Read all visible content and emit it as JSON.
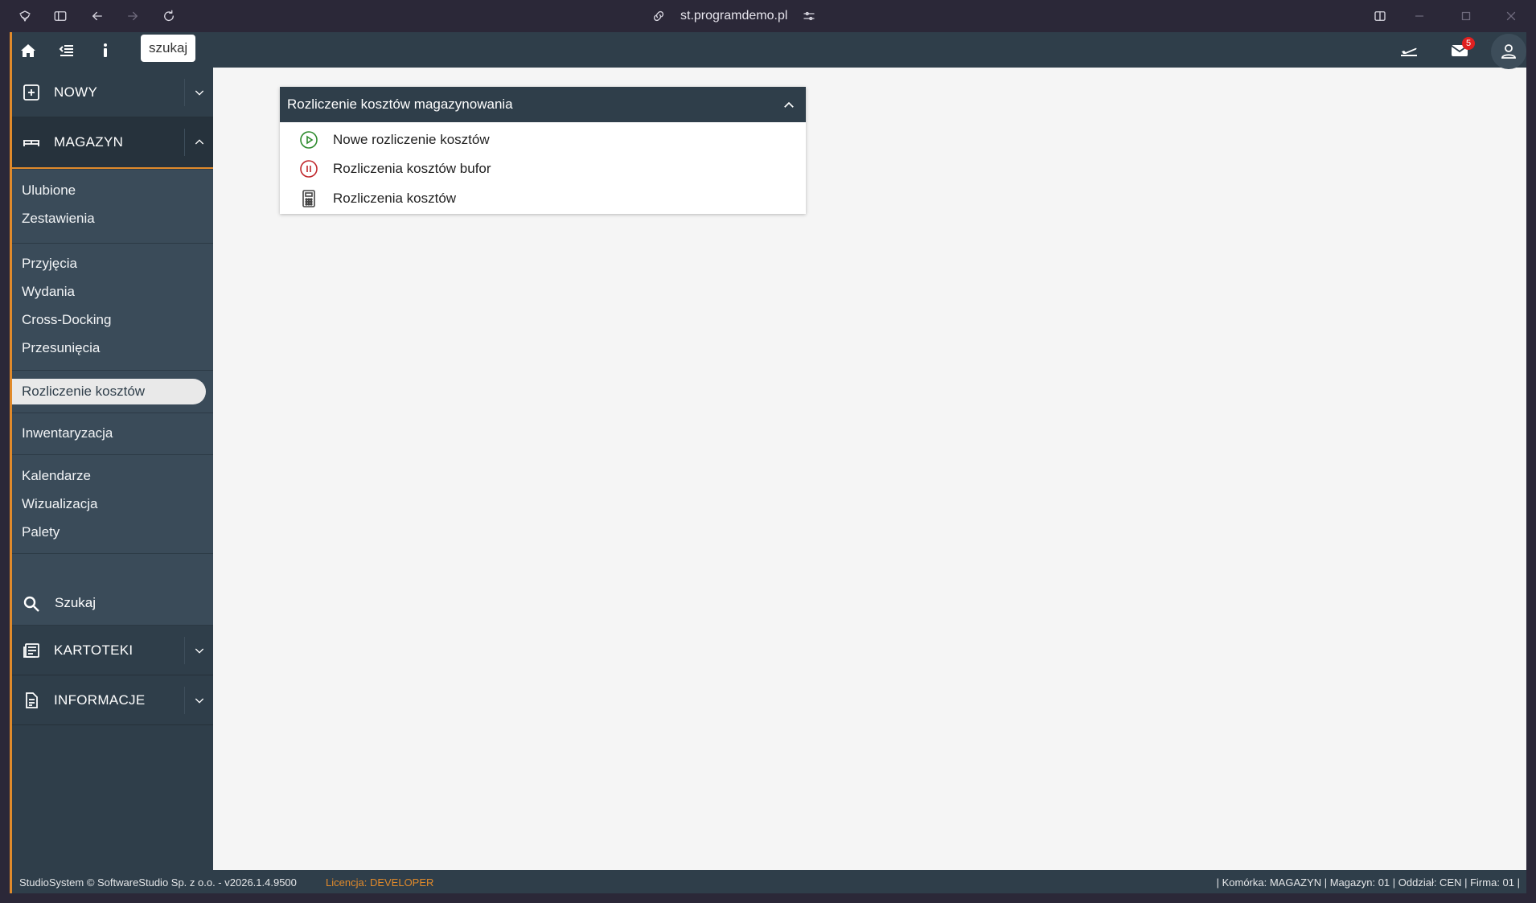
{
  "browser": {
    "url": "st.programdemo.pl"
  },
  "topbar": {
    "search_chip": "szukaj",
    "mail_count": "5"
  },
  "sidebar": {
    "sections": {
      "nowy": "NOWY",
      "magazyn": "MAGAZYN",
      "kartoteki": "KARTOTEKI",
      "informacje": "INFORMACJE"
    },
    "magazyn_items": {
      "ulubione": "Ulubione",
      "zestawienia": "Zestawienia",
      "przyjecia": "Przyjęcia",
      "wydania": "Wydania",
      "cross_docking": "Cross-Docking",
      "przesuniecia": "Przesunięcia",
      "rozliczenie": "Rozliczenie kosztów",
      "inwentaryzacja": "Inwentaryzacja",
      "kalendarze": "Kalendarze",
      "wizualizacja": "Wizualizacja",
      "palety": "Palety"
    },
    "search_label": "Szukaj"
  },
  "panel": {
    "title": "Rozliczenie kosztów magazynowania",
    "items": [
      {
        "label": "Nowe rozliczenie kosztów",
        "icon": "play-circle-icon",
        "color": "#2e8b2e"
      },
      {
        "label": "Rozliczenia kosztów bufor",
        "icon": "pause-circle-icon",
        "color": "#c0282d"
      },
      {
        "label": "Rozliczenia kosztów",
        "icon": "calculator-icon",
        "color": "#444444"
      }
    ]
  },
  "footer": {
    "left": "StudioSystem © SoftwareStudio Sp. z o.o. - v2026.1.4.9500",
    "license_label": "Licencja:",
    "license_value": "DEVELOPER",
    "right": "| Komórka: MAGAZYN | Magazyn: 01 | Oddział: CEN | Firma: 01 |"
  },
  "colors": {
    "sidebar": "#2f3e4a",
    "accent": "#e08a2b",
    "badge": "#e02020"
  }
}
